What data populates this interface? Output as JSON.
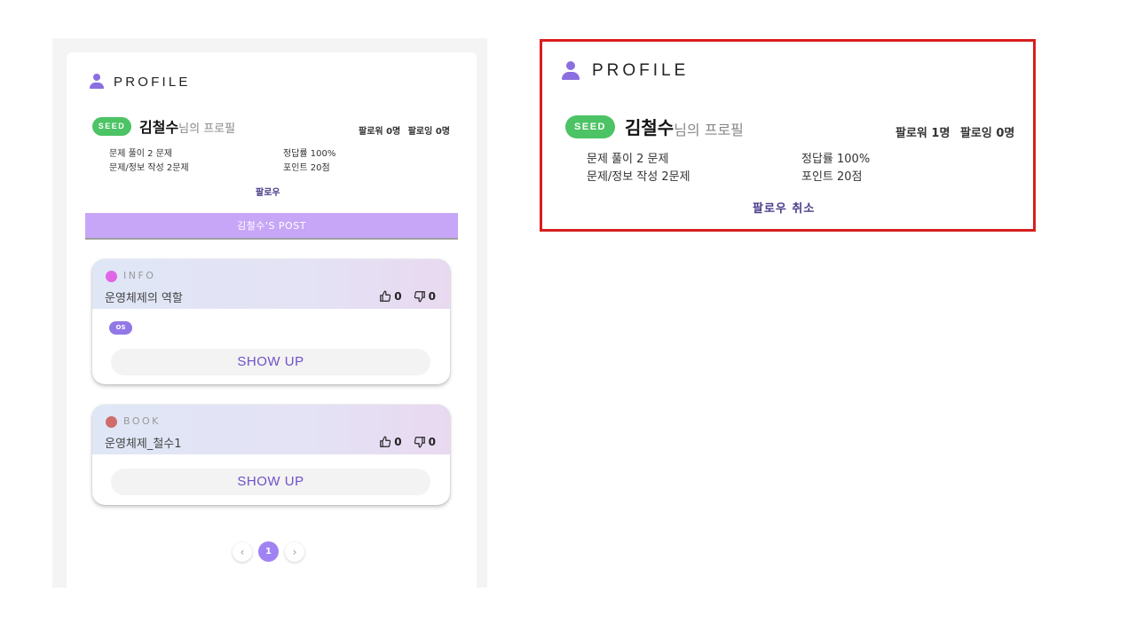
{
  "profile": {
    "title": "PROFILE",
    "badge": "SEED",
    "name": "김철수",
    "name_suffix": "님의 프로필",
    "left_panel": {
      "followers": "팔로워 0명",
      "following": "팔로잉 0명",
      "problems_solved": "문제 풀이 2 문제",
      "accuracy": "정답률 100%",
      "problems_written": "문제/정보 작성 2문제",
      "points": "포인트 20점",
      "follow_button": "팔로우"
    },
    "highlight_panel": {
      "followers": "팔로워 1명",
      "following": "팔로잉 0명",
      "problems_solved": "문제 풀이 2 문제",
      "accuracy": "정답률 100%",
      "problems_written": "문제/정보 작성 2문제",
      "points": "포인트 20점",
      "unfollow_button": "팔로우 취소"
    }
  },
  "posts_banner": "김철수'S POST",
  "posts": [
    {
      "category": "INFO",
      "category_color": "#e066e6",
      "title": "운영체제의 역할",
      "likes": "0",
      "dislikes": "0",
      "tag": "OS",
      "action": "SHOW UP"
    },
    {
      "category": "BOOK",
      "category_color": "#cf6b6b",
      "title": "운영체제_철수1",
      "likes": "0",
      "dislikes": "0",
      "action": "SHOW UP"
    }
  ],
  "pagination": {
    "prev": "‹",
    "current": "1",
    "next": "›"
  },
  "colors": {
    "accent": "#8b6fe0",
    "seed_badge": "#4cc365",
    "highlight_border": "#d81f1f"
  }
}
